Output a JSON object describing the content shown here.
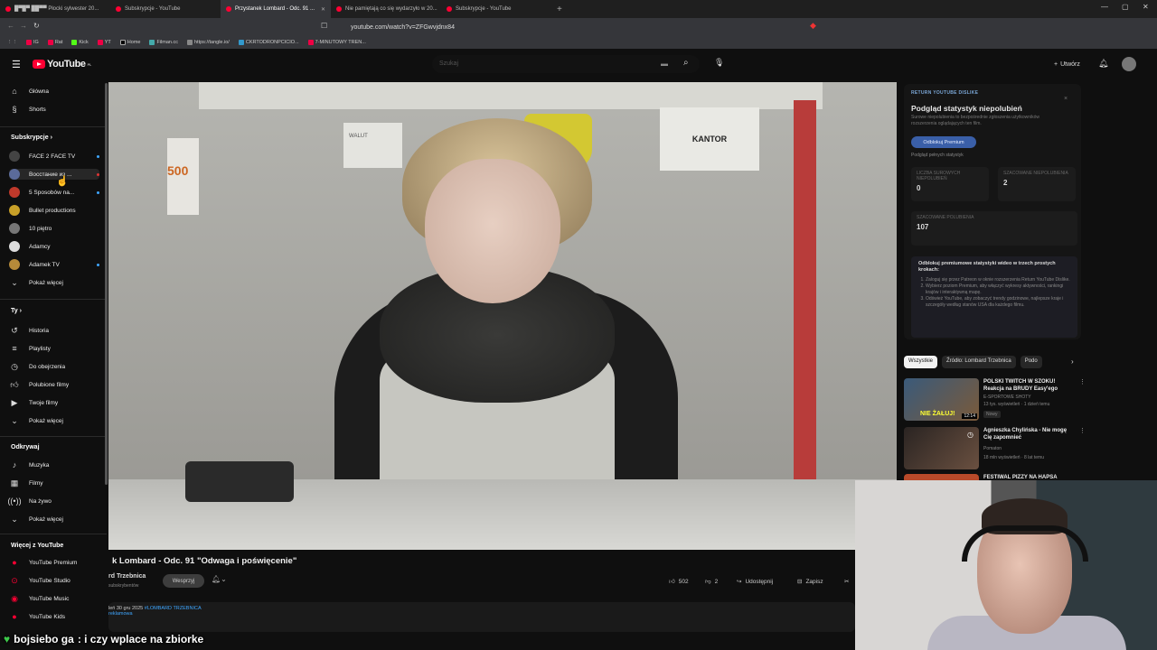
{
  "browser": {
    "tabs": [
      {
        "title": "█▀█▀ ██▀▀ Płocki sylwester 20..."
      },
      {
        "title": "Subskrypcje - YouTube"
      },
      {
        "title": "Przystanek Lombard - Odc. 91 ..."
      },
      {
        "title": "Nie pamiętają co się wydarzyło w 20..."
      },
      {
        "title": "Subskrypcje - YouTube"
      }
    ],
    "url": "youtube.com/watch?v=ZFGwvjdnx84",
    "bookmarks": [
      "IG",
      "Rat",
      "Kick",
      "YT",
      "Home",
      "Filman.cc",
      "https://tangle.io/",
      "CKRTODRONPCICIO...",
      "7-MINUTOWY TREN..."
    ]
  },
  "youtube": {
    "logo": "YouTube",
    "logo_sup": "PL",
    "search_placeholder": "Szukaj",
    "create_label": "Utwórz"
  },
  "sidebar": {
    "main": [
      {
        "label": "Główna",
        "icon": "home-icon"
      },
      {
        "label": "Shorts",
        "icon": "shorts-icon"
      }
    ],
    "subs_header": "Subskrypcje",
    "subs": [
      {
        "label": "FACE 2 FACE TV",
        "color": "#444444"
      },
      {
        "label": "Восстание из ...",
        "color": "#5b6b9a"
      },
      {
        "label": "5 Sposobów na...",
        "color": "#c0392b"
      },
      {
        "label": "Bullet productions",
        "color": "#c8a028"
      },
      {
        "label": "10 piętro",
        "color": "#777777"
      },
      {
        "label": "Adamcy",
        "color": "#dddddd"
      },
      {
        "label": "Adamek TV",
        "color": "#b58a3a"
      },
      {
        "label": "Pokaż więcej",
        "color": ""
      }
    ],
    "you_header": "Ty",
    "you": [
      {
        "label": "Historia",
        "icon": "history-icon"
      },
      {
        "label": "Playlisty",
        "icon": "playlist-icon"
      },
      {
        "label": "Do obejrzenia",
        "icon": "watch-later-icon"
      },
      {
        "label": "Polubione filmy",
        "icon": "like-icon"
      },
      {
        "label": "Twoje filmy",
        "icon": "your-videos-icon"
      },
      {
        "label": "Pokaż więcej",
        "icon": "chevron-down-icon"
      }
    ],
    "explore_header": "Odkrywaj",
    "explore": [
      {
        "label": "Muzyka",
        "icon": "music-icon"
      },
      {
        "label": "Filmy",
        "icon": "film-icon"
      },
      {
        "label": "Na żywo",
        "icon": "live-icon"
      },
      {
        "label": "Pokaż więcej",
        "icon": "chevron-down-icon"
      }
    ],
    "more_header": "Więcej z YouTube",
    "more": [
      {
        "label": "YouTube Premium"
      },
      {
        "label": "YouTube Studio"
      },
      {
        "label": "YouTube Music"
      },
      {
        "label": "YouTube Kids"
      }
    ]
  },
  "video": {
    "title": "k Lombard - Odc. 91 \"Odwaga i poświęcenie\"",
    "channel": "rd Trzebnica",
    "subs": "subskrybentów",
    "support_label": "Wesprzyj",
    "likes": "502",
    "dislikes": "2",
    "share_label": "Udostępnij",
    "save_label": "Zapisz",
    "date": "leń  30 gru 2025",
    "hashtag": "#LOMBARD TRZEBNICA",
    "sub_tag": "reklamowa",
    "scene_sign": "KANTOR",
    "scene_paper": "500",
    "scene_paper2": "WALUT"
  },
  "ryd": {
    "badge": "RETURN YOUTUBE DISLIKE",
    "title": "Podgląd statystyk niepolubień",
    "desc": "Surowe niepolubienia to bezpośrednie zgłoszenia użytkowników rozszerzenia oglądających ten film.",
    "premium_btn": "Odblokuj Premium",
    "full_link": "Podgląd pełnych statystyk",
    "raw_label": "LICZBA SUROWYCH NIEPOLUBIEŃ",
    "raw_value": "0",
    "est_label": "SZACOWANE NIEPOLUBIENIA",
    "est_value": "2",
    "likes_label": "SZACOWANE POLUBIENIA",
    "likes_value": "107",
    "promo_title": "Odblokuj premiumowe statystyki wideo w trzech prostych krokach:",
    "promo_steps": [
      "Zaloguj się przez Patreon w oknie rozszerzenia Return YouTube Dislike.",
      "Wybierz poziom Premium, aby włączyć wykresy aktywności, rankingi krajów i interaktywną mapę.",
      "Odśwież YouTube, aby zobaczyć trendy godzinowe, najlepsze kraje i szczegóły według stanów USA dla każdego filmu."
    ]
  },
  "chips": [
    "Wszystkie",
    "Źródło: Lombard Trzebnica",
    "Podo"
  ],
  "recs": [
    {
      "title": "POLSKI TWITCH W SZOKU! Reakcja na BRUDY Easy'ego",
      "channel": "E-SPORTOWE SHOTY",
      "meta": "13 tys. wyświetleń · 1 dzień temu",
      "badge": "Nowy",
      "thumb_text": "NIE ŻAŁUJ!",
      "duration": "12:14"
    },
    {
      "title": "Agnieszka Chylińska - Nie mogę Cię zapomnieć",
      "channel": "Pomaton",
      "meta": "18 mln wyświetleń · 8 lat temu",
      "badge": "",
      "thumb_text": "",
      "duration": ""
    },
    {
      "title": "FESTIWAL PIZZY NA HAPSA",
      "channel": "",
      "meta": "",
      "badge": "",
      "thumb_text": "",
      "duration": ""
    }
  ],
  "chat": {
    "user": "bojsiebo ga",
    "message": ": i czy wplace na zbiorke"
  }
}
